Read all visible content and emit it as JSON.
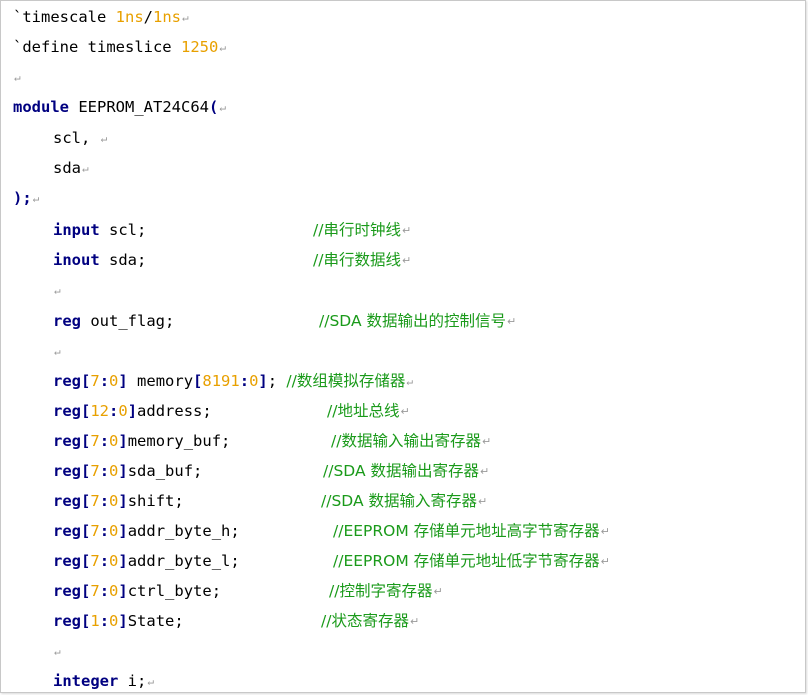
{
  "lines": [
    {
      "text": "`timescale 1ns/1ns"
    },
    {
      "text": "`define timeslice 1250"
    },
    {
      "text": ""
    },
    {
      "text": "module EEPROM_AT24C64("
    },
    {
      "text": "scl,"
    },
    {
      "text": "sda"
    },
    {
      "text": ");"
    },
    {
      "text": "input scl;",
      "comment": "//串行时钟线"
    },
    {
      "text": "inout sda;",
      "comment": "//串行数据线"
    },
    {
      "text": ""
    },
    {
      "text": "reg out_flag;",
      "comment": "//SDA 数据输出的控制信号"
    },
    {
      "text": ""
    },
    {
      "text": "reg[7:0] memory[8191:0];",
      "comment": "//数组模拟存储器"
    },
    {
      "text": "reg[12:0]address;",
      "comment": "//地址总线"
    },
    {
      "text": "reg[7:0]memory_buf;",
      "comment": "//数据输入输出寄存器"
    },
    {
      "text": "reg[7:0]sda_buf;",
      "comment": "//SDA 数据输出寄存器"
    },
    {
      "text": "reg[7:0]shift;",
      "comment": "//SDA 数据输入寄存器"
    },
    {
      "text": "reg[7:0]addr_byte_h;",
      "comment": "//EEPROM 存储单元地址高字节寄存器"
    },
    {
      "text": "reg[7:0]addr_byte_l;",
      "comment": "//EEPROM 存储单元地址低字节寄存器"
    },
    {
      "text": "reg[7:0]ctrl_byte;",
      "comment": "//控制字寄存器"
    },
    {
      "text": "reg[1:0]State;",
      "comment": "//状态寄存器"
    },
    {
      "text": ""
    },
    {
      "text": "integer i;"
    }
  ],
  "paragraph_mark": "↵",
  "colors": {
    "keyword": "#000080",
    "number": "#e8a000",
    "comment": "#1a9a1a",
    "text": "#000000",
    "paragraph_mark": "#9a9a9a"
  }
}
